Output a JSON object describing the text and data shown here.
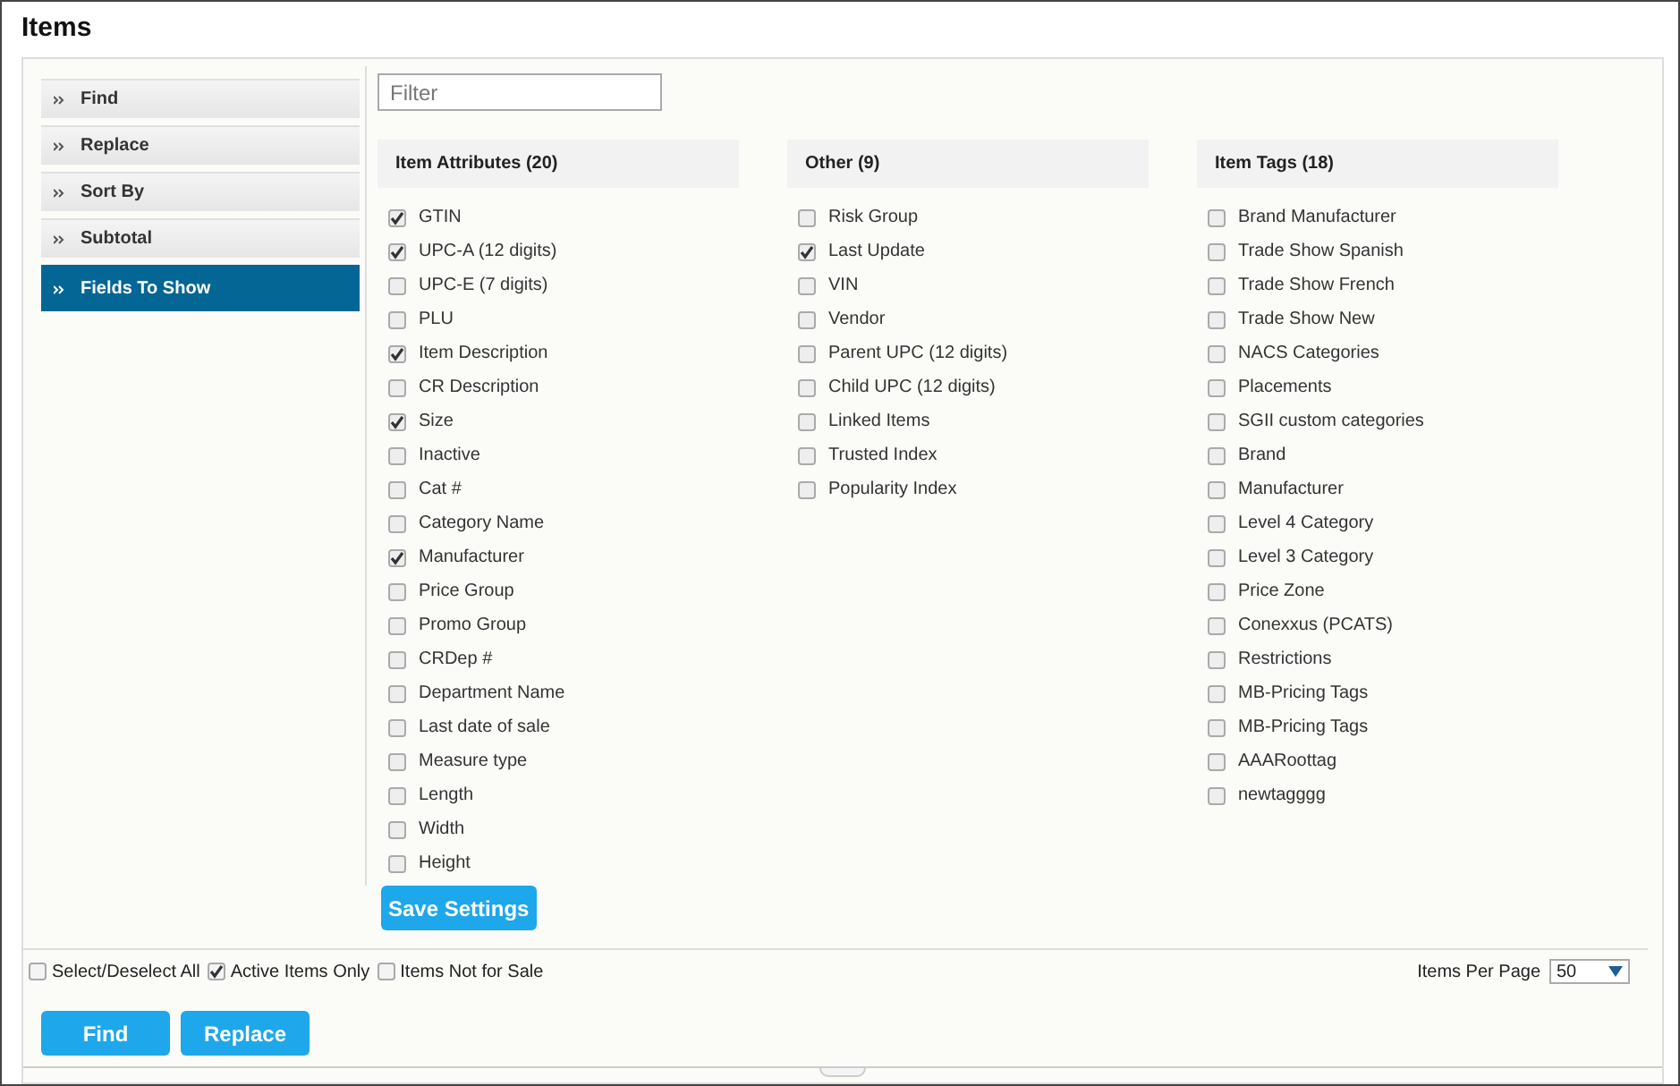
{
  "title": "Items",
  "sidebar": {
    "items": [
      {
        "label": "Find",
        "selected": false
      },
      {
        "label": "Replace",
        "selected": false
      },
      {
        "label": "Sort By",
        "selected": false
      },
      {
        "label": "Subtotal",
        "selected": false
      },
      {
        "label": "Fields To Show",
        "selected": true
      }
    ]
  },
  "filter": {
    "placeholder": "Filter"
  },
  "groups": [
    {
      "title": "Item Attributes (20)",
      "fields": [
        {
          "label": "GTIN",
          "checked": true
        },
        {
          "label": "UPC-A (12 digits)",
          "checked": true
        },
        {
          "label": "UPC-E (7 digits)",
          "checked": false
        },
        {
          "label": "PLU",
          "checked": false
        },
        {
          "label": "Item Description",
          "checked": true
        },
        {
          "label": "CR Description",
          "checked": false
        },
        {
          "label": "Size",
          "checked": true
        },
        {
          "label": "Inactive",
          "checked": false
        },
        {
          "label": "Cat #",
          "checked": false
        },
        {
          "label": "Category Name",
          "checked": false
        },
        {
          "label": "Manufacturer",
          "checked": true
        },
        {
          "label": "Price Group",
          "checked": false
        },
        {
          "label": "Promo Group",
          "checked": false
        },
        {
          "label": "CRDep #",
          "checked": false
        },
        {
          "label": "Department Name",
          "checked": false
        },
        {
          "label": "Last date of sale",
          "checked": false
        },
        {
          "label": "Measure type",
          "checked": false
        },
        {
          "label": "Length",
          "checked": false
        },
        {
          "label": "Width",
          "checked": false
        },
        {
          "label": "Height",
          "checked": false
        }
      ]
    },
    {
      "title": "Other (9)",
      "fields": [
        {
          "label": "Risk Group",
          "checked": false
        },
        {
          "label": "Last Update",
          "checked": true
        },
        {
          "label": "VIN",
          "checked": false
        },
        {
          "label": "Vendor",
          "checked": false
        },
        {
          "label": "Parent UPC (12 digits)",
          "checked": false
        },
        {
          "label": "Child UPC (12 digits)",
          "checked": false
        },
        {
          "label": "Linked Items",
          "checked": false
        },
        {
          "label": "Trusted Index",
          "checked": false
        },
        {
          "label": "Popularity Index",
          "checked": false
        }
      ]
    },
    {
      "title": "Item Tags (18)",
      "fields": [
        {
          "label": "Brand Manufacturer",
          "checked": false
        },
        {
          "label": "Trade Show Spanish",
          "checked": false
        },
        {
          "label": "Trade Show French",
          "checked": false
        },
        {
          "label": "Trade Show New",
          "checked": false
        },
        {
          "label": "NACS Categories",
          "checked": false
        },
        {
          "label": "Placements",
          "checked": false
        },
        {
          "label": "SGII custom categories",
          "checked": false
        },
        {
          "label": "Brand",
          "checked": false
        },
        {
          "label": "Manufacturer",
          "checked": false
        },
        {
          "label": "Level 4 Category",
          "checked": false
        },
        {
          "label": "Level 3 Category",
          "checked": false
        },
        {
          "label": "Price Zone",
          "checked": false
        },
        {
          "label": "Conexxus (PCATS)",
          "checked": false
        },
        {
          "label": "Restrictions",
          "checked": false
        },
        {
          "label": "MB-Pricing Tags",
          "checked": false
        },
        {
          "label": "MB-Pricing Tags",
          "checked": false
        },
        {
          "label": "AAARoottag",
          "checked": false
        },
        {
          "label": "newtagggg",
          "checked": false
        }
      ]
    }
  ],
  "save_button": "Save Settings",
  "options": [
    {
      "label": "Select/Deselect All",
      "checked": false
    },
    {
      "label": "Active Items Only",
      "checked": true
    },
    {
      "label": "Items Not for Sale",
      "checked": false
    }
  ],
  "items_per_page": {
    "label": "Items Per Page",
    "value": "50"
  },
  "buttons": [
    "Find",
    "Replace"
  ]
}
